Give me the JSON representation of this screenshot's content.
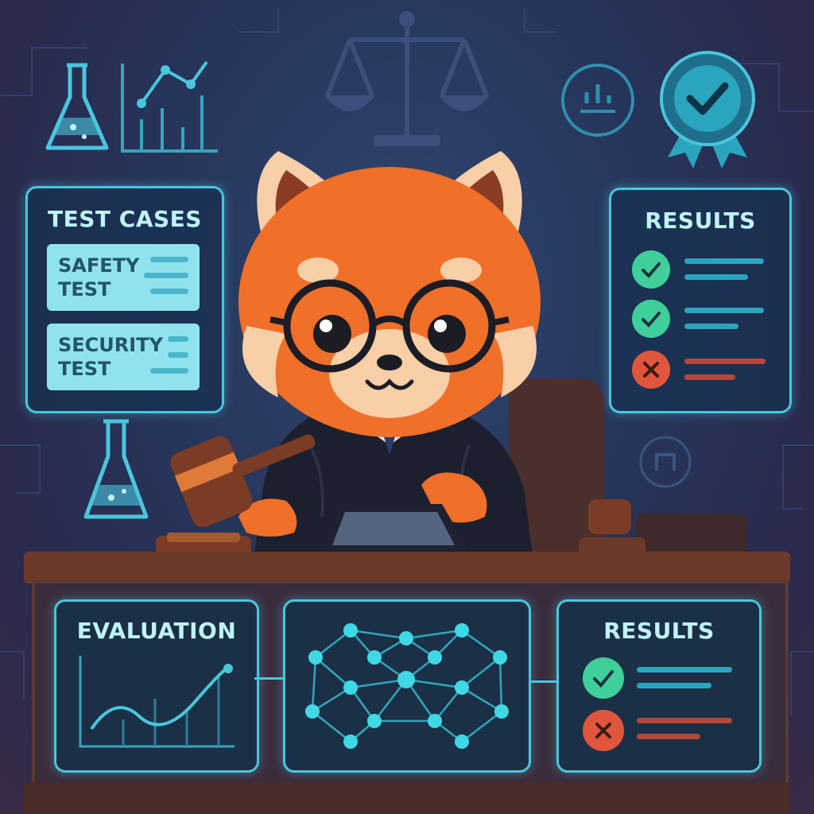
{
  "test_cases_panel": {
    "title": "TEST CASES",
    "cases": [
      {
        "label": "SAFETY\nTEST"
      },
      {
        "label": "SECURITY\nTEST"
      }
    ]
  },
  "results_panel_top": {
    "title": "RESULTS",
    "rows": [
      {
        "status": "pass",
        "icon": "check-icon"
      },
      {
        "status": "pass",
        "icon": "check-icon"
      },
      {
        "status": "fail",
        "icon": "x-icon"
      }
    ]
  },
  "evaluation_panel": {
    "title": "EVALUATION"
  },
  "results_panel_bottom": {
    "title": "RESULTS",
    "rows": [
      {
        "status": "pass",
        "icon": "check-icon"
      },
      {
        "status": "fail",
        "icon": "x-icon"
      }
    ]
  },
  "icons": [
    "flask-icon",
    "line-chart-icon",
    "scales-icon",
    "bar-gauge-icon",
    "award-badge-icon",
    "gavel-icon",
    "tablet-icon",
    "neural-network-icon"
  ],
  "colors": {
    "accent": "#49c6dd",
    "pass": "#3fcf9a",
    "fail": "#e0563d",
    "fur": "#f0702a",
    "robe": "#1c1f2e",
    "desk": "#6b3a2a"
  }
}
